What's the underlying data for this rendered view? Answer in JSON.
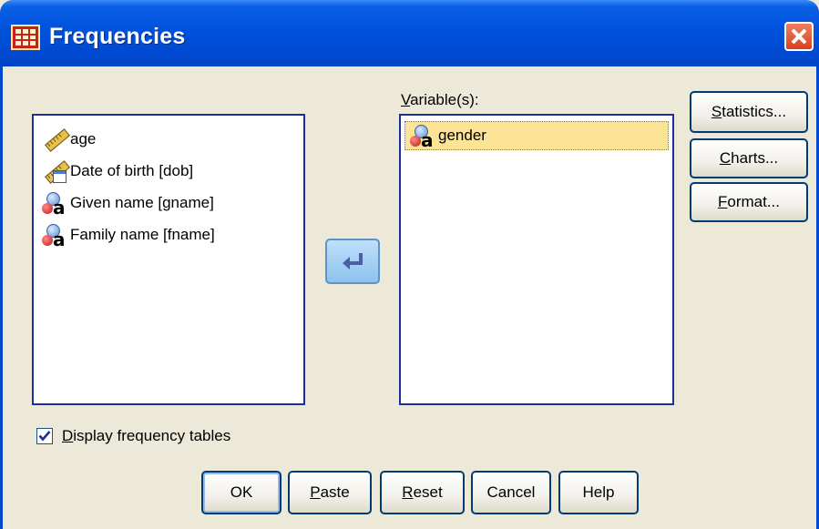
{
  "dialog": {
    "title": "Frequencies",
    "accent": "#0A5FE6"
  },
  "source_list": {
    "items": [
      {
        "label": "age",
        "icon": "ruler-icon"
      },
      {
        "label": "Date of birth [dob]",
        "icon": "date-ruler-icon"
      },
      {
        "label": "Given name [gname]",
        "icon": "nominal-string-icon"
      },
      {
        "label": "Family name [fname]",
        "icon": "nominal-string-icon"
      }
    ]
  },
  "target_list": {
    "label_prefix": "V",
    "label_rest": "ariable(s):",
    "items": [
      {
        "label": "gender",
        "icon": "nominal-string-icon",
        "selected": true
      }
    ]
  },
  "side_buttons": {
    "statistics": {
      "mn": "S",
      "rest": "tatistics..."
    },
    "charts": {
      "mn": "C",
      "rest": "harts..."
    },
    "format": {
      "mn": "F",
      "rest": "ormat..."
    }
  },
  "move_button": {
    "icon": "move-arrow-icon"
  },
  "options": {
    "display_frequency_tables": {
      "mn": "D",
      "rest": "isplay frequency tables",
      "checked": true
    }
  },
  "footer_buttons": {
    "ok": "OK",
    "paste": {
      "mn": "P",
      "rest": "aste"
    },
    "reset": {
      "mn": "R",
      "rest": "eset"
    },
    "cancel": "Cancel",
    "help": "Help"
  }
}
